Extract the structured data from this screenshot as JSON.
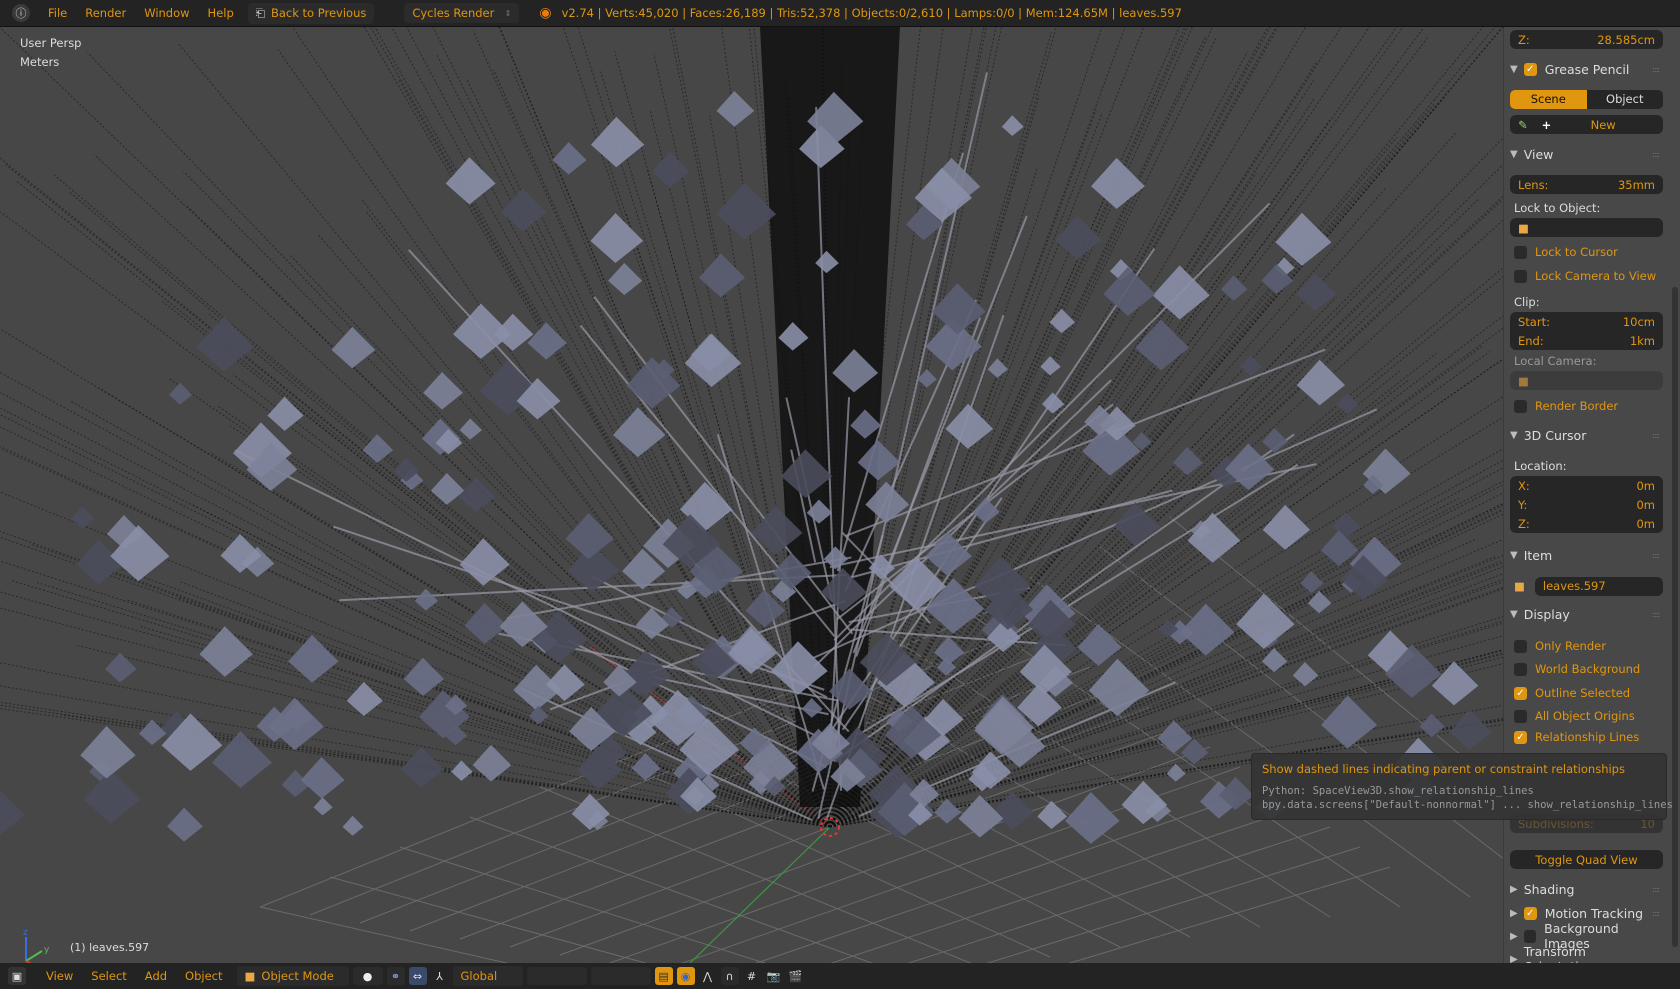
{
  "topbar": {
    "menus": [
      "File",
      "Render",
      "Window",
      "Help"
    ],
    "back_label": "Back to Previous",
    "engine": "Cycles Render",
    "stats": "v2.74 | Verts:45,020 | Faces:26,189 | Tris:52,378 | Objects:0/2,610 | Lamps:0/0 | Mem:124.65M | leaves.597"
  },
  "viewport": {
    "view_name": "User Persp",
    "units": "Meters",
    "object_label": "(1) leaves.597",
    "axes": {
      "x": "x",
      "y": "y",
      "z": "z"
    }
  },
  "panel": {
    "z_label": "Z:",
    "z_value": "28.585cm",
    "grease_pencil": {
      "title": "Grease Pencil",
      "enabled": true,
      "tabs": [
        "Scene",
        "Object"
      ],
      "active_tab": "Scene",
      "new_label": "New"
    },
    "view": {
      "title": "View",
      "lens_label": "Lens:",
      "lens_value": "35mm",
      "lock_object_label": "Lock to Object:",
      "lock_cursor": "Lock to Cursor",
      "lock_camera": "Lock Camera to View",
      "clip_label": "Clip:",
      "start_label": "Start:",
      "start_value": "10cm",
      "end_label": "End:",
      "end_value": "1km",
      "local_camera_label": "Local Camera:",
      "render_border": "Render Border"
    },
    "cursor": {
      "title": "3D Cursor",
      "location_label": "Location:",
      "x_label": "X:",
      "x": "0m",
      "y_label": "Y:",
      "y": "0m",
      "z_label": "Z:",
      "z": "0m"
    },
    "item": {
      "title": "Item",
      "name": "leaves.597"
    },
    "display": {
      "title": "Display",
      "options": [
        {
          "label": "Only Render",
          "checked": false
        },
        {
          "label": "World Background",
          "checked": false
        },
        {
          "label": "Outline Selected",
          "checked": true
        },
        {
          "label": "All Object Origins",
          "checked": false
        },
        {
          "label": "Relationship Lines",
          "checked": true
        }
      ],
      "subdivisions_label": "Subdivisions:",
      "subdivisions_value": "10",
      "toggle_quad": "Toggle Quad View"
    },
    "collapsed": [
      {
        "title": "Shading"
      },
      {
        "title": "Motion Tracking",
        "checked": true
      },
      {
        "title": "Background Images",
        "checked": false
      },
      {
        "title": "Transform Orientations"
      }
    ]
  },
  "tooltip": {
    "text": "Show dashed lines indicating parent or constraint relationships",
    "python": "Python: SpaceView3D.show_relationship_lines",
    "path": "bpy.data.screens[\"Default-nonnormal\"] ... show_relationship_lines"
  },
  "bottombar": {
    "menus": [
      "View",
      "Select",
      "Add",
      "Object"
    ],
    "mode": "Object Mode",
    "orientation": "Global"
  },
  "colors": {
    "accent": "#e0960f",
    "header": "#232323",
    "panel": "#484848",
    "viewport": "#474747"
  }
}
